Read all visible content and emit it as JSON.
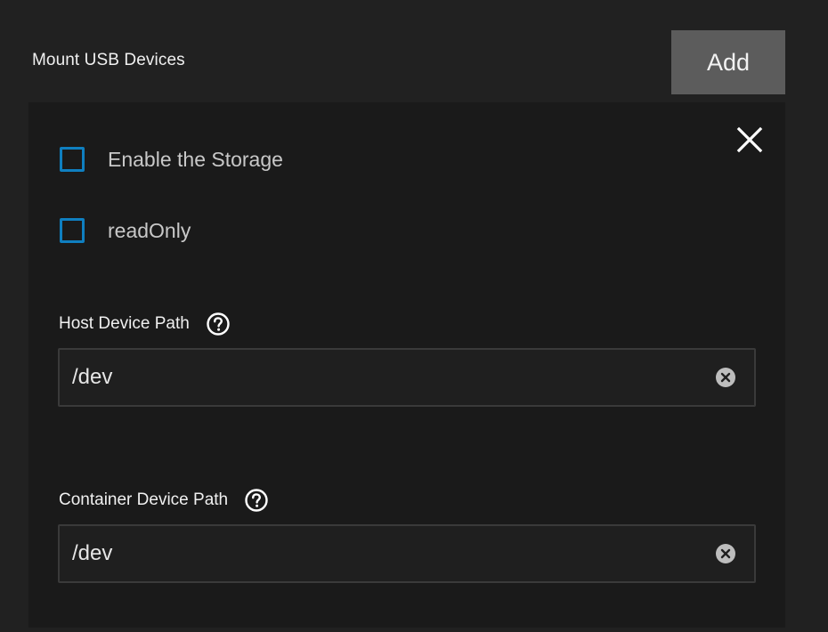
{
  "section": {
    "title": "Mount USB Devices",
    "add_label": "Add"
  },
  "card": {
    "close_icon": "close-icon",
    "checkboxes": [
      {
        "label": "Enable the Storage",
        "checked": false
      },
      {
        "label": "readOnly",
        "checked": false
      }
    ],
    "fields": [
      {
        "label": "Host Device Path",
        "value": "/dev",
        "help_icon": "help-icon",
        "clear_icon": "clear-icon"
      },
      {
        "label": "Container Device Path",
        "value": "/dev",
        "help_icon": "help-icon",
        "clear_icon": "clear-icon"
      }
    ]
  },
  "colors": {
    "background": "#212121",
    "card_background": "#1a1a1a",
    "button_background": "#5c5c5c",
    "checkbox_border": "#0f7fc0"
  }
}
